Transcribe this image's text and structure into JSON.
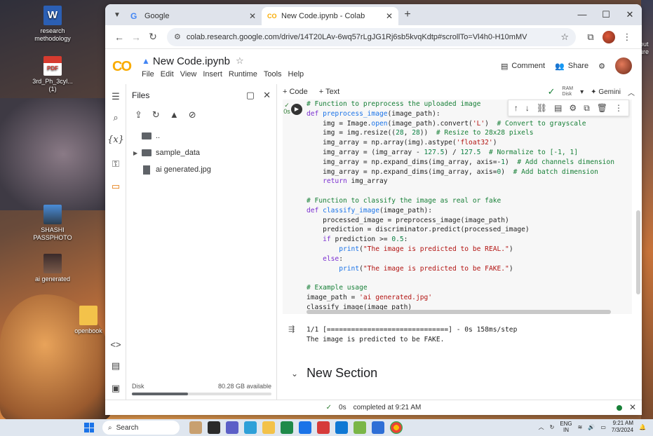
{
  "desktop": {
    "icons": [
      {
        "label": "research methodology"
      },
      {
        "label": "3rd_Ph_3cyl... (1)"
      },
      {
        "label": "SHASHI PASSPHOTO"
      },
      {
        "label": "ai generated"
      },
      {
        "label": "openbook"
      }
    ],
    "edge_text": "out ure"
  },
  "browser": {
    "tabs": [
      {
        "title": "Google",
        "favicon": "G"
      },
      {
        "title": "New Code.ipynb - Colab",
        "favicon": "CO"
      }
    ],
    "url": "colab.research.google.com/drive/14T20LAv-6wq57rLgJG1Rj6sb5kvqKdtp#scrollTo=Vl4h0-H10mMV"
  },
  "colab": {
    "logo": "CO",
    "notebook_title": "New Code.ipynb",
    "menus": [
      "File",
      "Edit",
      "View",
      "Insert",
      "Runtime",
      "Tools",
      "Help"
    ],
    "comment_label": "Comment",
    "share_label": "Share",
    "add_code": "+ Code",
    "add_text": "+ Text",
    "ram_label": "RAM",
    "disk_label": "Disk",
    "gemini_label": "Gemini",
    "files_title": "Files",
    "tree": [
      {
        "name": ".."
      },
      {
        "name": "sample_data"
      },
      {
        "name": "ai generated.jpg"
      }
    ],
    "disk_text": "Disk",
    "disk_available": "80.28 GB available",
    "disk_usage_fraction": 0.4,
    "run_time": "0s",
    "output_lines": [
      "1/1 [==============================] - 0s 158ms/step",
      "The image is predicted to be FAKE."
    ],
    "section_title": "New Section",
    "status_time": "0s",
    "status_text": "completed at 9:21 AM"
  },
  "taskbar": {
    "search_label": "Search",
    "lang": "ENG",
    "region": "IN",
    "time": "9:21 AM",
    "date": "7/3/2024"
  },
  "colors": {
    "accent": "#e37400",
    "colab_orange": "#f9ab00",
    "ok_green": "#188038"
  }
}
